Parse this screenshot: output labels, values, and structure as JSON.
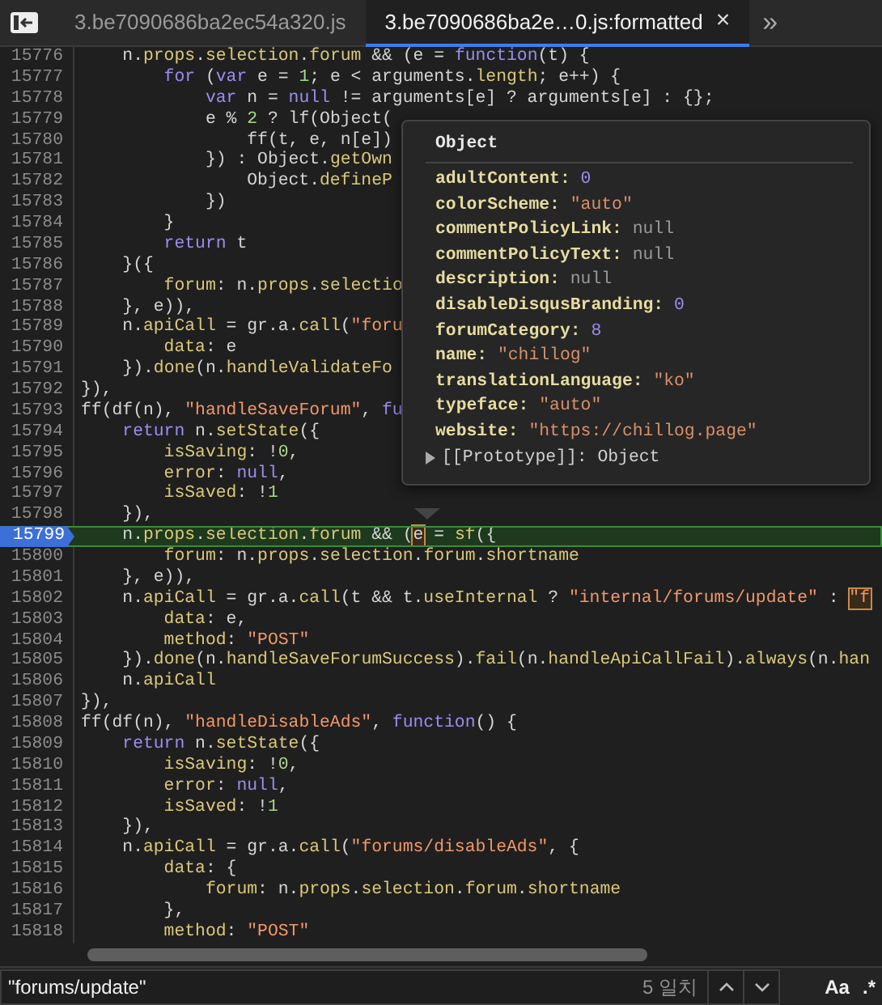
{
  "tabs": [
    {
      "label": "3.be7090686ba2ec54a320.js",
      "selected": false
    },
    {
      "label": "3.be7090686ba2e…0.js:formatted",
      "selected": true,
      "close": "×"
    }
  ],
  "overflow_button": "»",
  "code": {
    "lines": [
      {
        "num": "15776",
        "current": false,
        "tokens": [
          {
            "text": "    n.",
            "kind": "p"
          },
          {
            "text": "props",
            "kind": "a"
          },
          {
            "text": ".",
            "kind": "p"
          },
          {
            "text": "selection",
            "kind": "a"
          },
          {
            "text": ".",
            "kind": "p"
          },
          {
            "text": "forum",
            "kind": "a"
          },
          {
            "text": " && (e = ",
            "kind": "p"
          },
          {
            "text": "function",
            "kind": "k"
          },
          {
            "text": "(t) {",
            "kind": "p"
          }
        ]
      },
      {
        "num": "15777",
        "current": false,
        "tokens": [
          {
            "text": "        for",
            "kind": "k"
          },
          {
            "text": " (",
            "kind": "p"
          },
          {
            "text": "var",
            "kind": "k"
          },
          {
            "text": " e = ",
            "kind": "p"
          },
          {
            "text": "1",
            "kind": "n"
          },
          {
            "text": "; e < arguments.",
            "kind": "p"
          },
          {
            "text": "length",
            "kind": "a"
          },
          {
            "text": "; e++) {",
            "kind": "p"
          }
        ]
      },
      {
        "num": "15778",
        "current": false,
        "tokens": [
          {
            "text": "            var",
            "kind": "k"
          },
          {
            "text": " n = ",
            "kind": "p"
          },
          {
            "text": "null",
            "kind": "k"
          },
          {
            "text": " != arguments[e] ? arguments[e] : {};",
            "kind": "p"
          }
        ]
      },
      {
        "num": "15779",
        "current": false,
        "tokens": [
          {
            "text": "            e % ",
            "kind": "p"
          },
          {
            "text": "2",
            "kind": "n"
          },
          {
            "text": " ? lf(Object(",
            "kind": "p"
          }
        ]
      },
      {
        "num": "15780",
        "current": false,
        "tokens": [
          {
            "text": "                ff(t, e, n[e])",
            "kind": "p"
          }
        ]
      },
      {
        "num": "15781",
        "current": false,
        "tokens": [
          {
            "text": "            }) : Object.",
            "kind": "p"
          },
          {
            "text": "getOwn",
            "kind": "a"
          }
        ]
      },
      {
        "num": "15782",
        "current": false,
        "tokens": [
          {
            "text": "                Object.",
            "kind": "p"
          },
          {
            "text": "defineP",
            "kind": "a"
          }
        ]
      },
      {
        "num": "15783",
        "current": false,
        "tokens": [
          {
            "text": "            })",
            "kind": "p"
          }
        ]
      },
      {
        "num": "15784",
        "current": false,
        "tokens": [
          {
            "text": "        }",
            "kind": "p"
          }
        ]
      },
      {
        "num": "15785",
        "current": false,
        "tokens": [
          {
            "text": "        return",
            "kind": "k"
          },
          {
            "text": " t",
            "kind": "p"
          }
        ]
      },
      {
        "num": "15786",
        "current": false,
        "tokens": [
          {
            "text": "    }({",
            "kind": "p"
          }
        ]
      },
      {
        "num": "15787",
        "current": false,
        "tokens": [
          {
            "text": "        forum",
            "kind": "a"
          },
          {
            "text": ": n.",
            "kind": "p"
          },
          {
            "text": "props",
            "kind": "a"
          },
          {
            "text": ".",
            "kind": "p"
          },
          {
            "text": "selectio",
            "kind": "a"
          }
        ]
      },
      {
        "num": "15788",
        "current": false,
        "tokens": [
          {
            "text": "    }, e)),",
            "kind": "p"
          }
        ]
      },
      {
        "num": "15789",
        "current": false,
        "tokens": [
          {
            "text": "    n.",
            "kind": "p"
          },
          {
            "text": "apiCall",
            "kind": "a"
          },
          {
            "text": " = gr.a.",
            "kind": "p"
          },
          {
            "text": "call",
            "kind": "a"
          },
          {
            "text": "(",
            "kind": "p"
          },
          {
            "text": "\"foru",
            "kind": "s"
          }
        ]
      },
      {
        "num": "15790",
        "current": false,
        "tokens": [
          {
            "text": "        data",
            "kind": "a"
          },
          {
            "text": ": e",
            "kind": "p"
          }
        ]
      },
      {
        "num": "15791",
        "current": false,
        "tokens": [
          {
            "text": "    }).",
            "kind": "p"
          },
          {
            "text": "done",
            "kind": "a"
          },
          {
            "text": "(n.",
            "kind": "p"
          },
          {
            "text": "handleValidateFo",
            "kind": "a"
          }
        ]
      },
      {
        "num": "15792",
        "current": false,
        "tokens": [
          {
            "text": "}),",
            "kind": "p"
          }
        ]
      },
      {
        "num": "15793",
        "current": false,
        "tokens": [
          {
            "text": "ff(df(n), ",
            "kind": "p"
          },
          {
            "text": "\"handleSaveForum\"",
            "kind": "s"
          },
          {
            "text": ", ",
            "kind": "p"
          },
          {
            "text": "fu",
            "kind": "k"
          }
        ]
      },
      {
        "num": "15794",
        "current": false,
        "tokens": [
          {
            "text": "    return",
            "kind": "k"
          },
          {
            "text": " n.",
            "kind": "p"
          },
          {
            "text": "setState",
            "kind": "a"
          },
          {
            "text": "({",
            "kind": "p"
          }
        ]
      },
      {
        "num": "15795",
        "current": false,
        "tokens": [
          {
            "text": "        isSaving",
            "kind": "a"
          },
          {
            "text": ": !",
            "kind": "p"
          },
          {
            "text": "0",
            "kind": "n"
          },
          {
            "text": ",",
            "kind": "p"
          }
        ]
      },
      {
        "num": "15796",
        "current": false,
        "tokens": [
          {
            "text": "        error",
            "kind": "a"
          },
          {
            "text": ": ",
            "kind": "p"
          },
          {
            "text": "null",
            "kind": "k"
          },
          {
            "text": ",",
            "kind": "p"
          }
        ]
      },
      {
        "num": "15797",
        "current": false,
        "tokens": [
          {
            "text": "        isSaved",
            "kind": "a"
          },
          {
            "text": ": !",
            "kind": "p"
          },
          {
            "text": "1",
            "kind": "n"
          }
        ]
      },
      {
        "num": "15798",
        "current": false,
        "tokens": [
          {
            "text": "    }),",
            "kind": "p"
          }
        ]
      },
      {
        "num": "15799",
        "current": true,
        "tokens": [
          {
            "text": "    n.",
            "kind": "p"
          },
          {
            "text": "props",
            "kind": "a"
          },
          {
            "text": ".",
            "kind": "p"
          },
          {
            "text": "selection",
            "kind": "a"
          },
          {
            "text": ".",
            "kind": "p"
          },
          {
            "text": "forum",
            "kind": "a"
          },
          {
            "text": " && (",
            "kind": "p"
          },
          {
            "text": "e",
            "kind": "pm"
          },
          {
            "text": " = ",
            "kind": "p"
          },
          {
            "text": "sf",
            "kind": "a"
          },
          {
            "text": "({",
            "kind": "p"
          }
        ]
      },
      {
        "num": "15800",
        "current": false,
        "tokens": [
          {
            "text": "        forum",
            "kind": "a"
          },
          {
            "text": ": n.",
            "kind": "p"
          },
          {
            "text": "props",
            "kind": "a"
          },
          {
            "text": ".",
            "kind": "p"
          },
          {
            "text": "selection",
            "kind": "a"
          },
          {
            "text": ".",
            "kind": "p"
          },
          {
            "text": "forum",
            "kind": "a"
          },
          {
            "text": ".",
            "kind": "p"
          },
          {
            "text": "shortname",
            "kind": "a"
          }
        ]
      },
      {
        "num": "15801",
        "current": false,
        "tokens": [
          {
            "text": "    }, e)),",
            "kind": "p"
          }
        ]
      },
      {
        "num": "15802",
        "current": false,
        "tokens": [
          {
            "text": "    n.",
            "kind": "p"
          },
          {
            "text": "apiCall",
            "kind": "a"
          },
          {
            "text": " = gr.a.",
            "kind": "p"
          },
          {
            "text": "call",
            "kind": "a"
          },
          {
            "text": "(t && t.",
            "kind": "p"
          },
          {
            "text": "useInternal",
            "kind": "a"
          },
          {
            "text": " ? ",
            "kind": "p"
          },
          {
            "text": "\"internal/forums/update\"",
            "kind": "s"
          },
          {
            "text": " : ",
            "kind": "p"
          },
          {
            "text": "\"f",
            "kind": "sm"
          }
        ]
      },
      {
        "num": "15803",
        "current": false,
        "tokens": [
          {
            "text": "        data",
            "kind": "a"
          },
          {
            "text": ": e,",
            "kind": "p"
          }
        ]
      },
      {
        "num": "15804",
        "current": false,
        "tokens": [
          {
            "text": "        method",
            "kind": "a"
          },
          {
            "text": ": ",
            "kind": "p"
          },
          {
            "text": "\"POST\"",
            "kind": "s"
          }
        ]
      },
      {
        "num": "15805",
        "current": false,
        "tokens": [
          {
            "text": "    }).",
            "kind": "p"
          },
          {
            "text": "done",
            "kind": "a"
          },
          {
            "text": "(n.",
            "kind": "p"
          },
          {
            "text": "handleSaveForumSuccess",
            "kind": "a"
          },
          {
            "text": ").",
            "kind": "p"
          },
          {
            "text": "fail",
            "kind": "a"
          },
          {
            "text": "(n.",
            "kind": "p"
          },
          {
            "text": "handleApiCallFail",
            "kind": "a"
          },
          {
            "text": ").",
            "kind": "p"
          },
          {
            "text": "always",
            "kind": "a"
          },
          {
            "text": "(n.",
            "kind": "p"
          },
          {
            "text": "han",
            "kind": "a"
          }
        ]
      },
      {
        "num": "15806",
        "current": false,
        "tokens": [
          {
            "text": "    n.",
            "kind": "p"
          },
          {
            "text": "apiCall",
            "kind": "a"
          }
        ]
      },
      {
        "num": "15807",
        "current": false,
        "tokens": [
          {
            "text": "}),",
            "kind": "p"
          }
        ]
      },
      {
        "num": "15808",
        "current": false,
        "tokens": [
          {
            "text": "ff(df(n), ",
            "kind": "p"
          },
          {
            "text": "\"handleDisableAds\"",
            "kind": "s"
          },
          {
            "text": ", ",
            "kind": "p"
          },
          {
            "text": "function",
            "kind": "k"
          },
          {
            "text": "() {",
            "kind": "p"
          }
        ]
      },
      {
        "num": "15809",
        "current": false,
        "tokens": [
          {
            "text": "    return",
            "kind": "k"
          },
          {
            "text": " n.",
            "kind": "p"
          },
          {
            "text": "setState",
            "kind": "a"
          },
          {
            "text": "({",
            "kind": "p"
          }
        ]
      },
      {
        "num": "15810",
        "current": false,
        "tokens": [
          {
            "text": "        isSaving",
            "kind": "a"
          },
          {
            "text": ": !",
            "kind": "p"
          },
          {
            "text": "0",
            "kind": "n"
          },
          {
            "text": ",",
            "kind": "p"
          }
        ]
      },
      {
        "num": "15811",
        "current": false,
        "tokens": [
          {
            "text": "        error",
            "kind": "a"
          },
          {
            "text": ": ",
            "kind": "p"
          },
          {
            "text": "null",
            "kind": "k"
          },
          {
            "text": ",",
            "kind": "p"
          }
        ]
      },
      {
        "num": "15812",
        "current": false,
        "tokens": [
          {
            "text": "        isSaved",
            "kind": "a"
          },
          {
            "text": ": !",
            "kind": "p"
          },
          {
            "text": "1",
            "kind": "n"
          }
        ]
      },
      {
        "num": "15813",
        "current": false,
        "tokens": [
          {
            "text": "    }),",
            "kind": "p"
          }
        ]
      },
      {
        "num": "15814",
        "current": false,
        "tokens": [
          {
            "text": "    n.",
            "kind": "p"
          },
          {
            "text": "apiCall",
            "kind": "a"
          },
          {
            "text": " = gr.a.",
            "kind": "p"
          },
          {
            "text": "call",
            "kind": "a"
          },
          {
            "text": "(",
            "kind": "p"
          },
          {
            "text": "\"forums/disableAds\"",
            "kind": "s"
          },
          {
            "text": ", {",
            "kind": "p"
          }
        ]
      },
      {
        "num": "15815",
        "current": false,
        "tokens": [
          {
            "text": "        data",
            "kind": "a"
          },
          {
            "text": ": {",
            "kind": "p"
          }
        ]
      },
      {
        "num": "15816",
        "current": false,
        "tokens": [
          {
            "text": "            forum",
            "kind": "a"
          },
          {
            "text": ": n.",
            "kind": "p"
          },
          {
            "text": "props",
            "kind": "a"
          },
          {
            "text": ".",
            "kind": "p"
          },
          {
            "text": "selection",
            "kind": "a"
          },
          {
            "text": ".",
            "kind": "p"
          },
          {
            "text": "forum",
            "kind": "a"
          },
          {
            "text": ".",
            "kind": "p"
          },
          {
            "text": "shortname",
            "kind": "a"
          }
        ]
      },
      {
        "num": "15817",
        "current": false,
        "tokens": [
          {
            "text": "        },",
            "kind": "p"
          }
        ]
      },
      {
        "num": "15818",
        "current": false,
        "tokens": [
          {
            "text": "        method",
            "kind": "a"
          },
          {
            "text": ": ",
            "kind": "p"
          },
          {
            "text": "\"POST\"",
            "kind": "s"
          }
        ]
      }
    ]
  },
  "popover": {
    "title": "Object",
    "properties": [
      {
        "key": "adultContent:",
        "value": "0",
        "kind": "number"
      },
      {
        "key": "colorScheme:",
        "value": "\"auto\"",
        "kind": "string"
      },
      {
        "key": "commentPolicyLink:",
        "value": "null",
        "kind": "null"
      },
      {
        "key": "commentPolicyText:",
        "value": "null",
        "kind": "null"
      },
      {
        "key": "description:",
        "value": "null",
        "kind": "null"
      },
      {
        "key": "disableDisqusBranding:",
        "value": "0",
        "kind": "number"
      },
      {
        "key": "forumCategory:",
        "value": "8",
        "kind": "number"
      },
      {
        "key": "name:",
        "value": "\"chillog\"",
        "kind": "string"
      },
      {
        "key": "translationLanguage:",
        "value": "\"ko\"",
        "kind": "string"
      },
      {
        "key": "typeface:",
        "value": "\"auto\"",
        "kind": "string"
      },
      {
        "key": "website:",
        "value": "\"https://chillog.page\"",
        "kind": "string"
      }
    ],
    "prototype": {
      "label": "[[Prototype]]: Object",
      "expanded": false
    }
  },
  "search": {
    "value": "\"forums/update\"",
    "match_count": "5 일치",
    "case_button": "Aa",
    "regex_button": ".*"
  }
}
